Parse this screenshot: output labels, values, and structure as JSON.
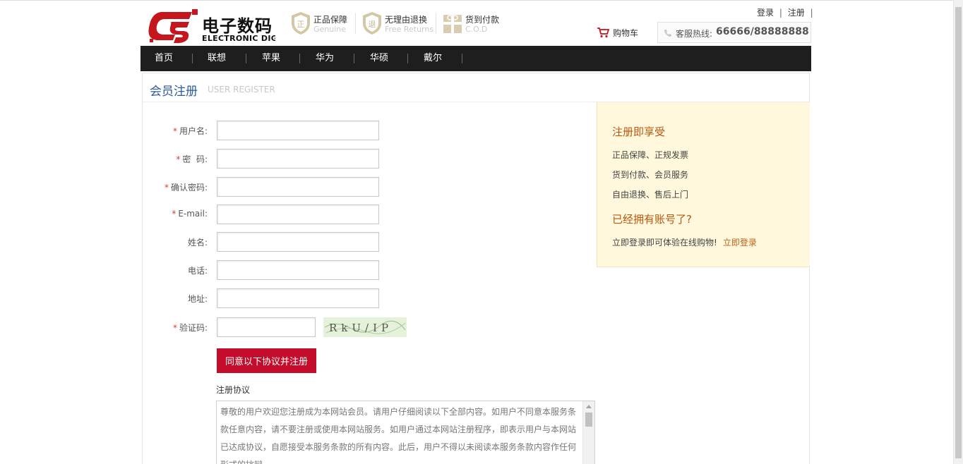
{
  "header": {
    "logo_text": "电子数码",
    "logo_sub": "ELECTRONIC DIGITAL",
    "guarantees": [
      {
        "title": "正品保障",
        "en": "Genuine",
        "icon": "shield-icon"
      },
      {
        "title": "无理由退换",
        "en": "Free Returns",
        "icon": "return-icon"
      },
      {
        "title": "货到付款",
        "en": "C.O.D",
        "icon": "gift-icon"
      }
    ],
    "login_link": "登录",
    "register_link": "注册",
    "link_sep": "|",
    "cart_label": "购物车",
    "hotline_label": "客服热线:",
    "hotline_number": "66666/88888888"
  },
  "nav": {
    "items": [
      "首页",
      "联想",
      "苹果",
      "华为",
      "华硕",
      "戴尔"
    ]
  },
  "panel": {
    "title": "会员注册",
    "title_en": "USER REGISTER"
  },
  "form": {
    "required_mark": "*",
    "fields": [
      {
        "label": "用户名:",
        "required": true,
        "value": ""
      },
      {
        "label": "密  码:",
        "required": true,
        "value": ""
      },
      {
        "label": "确认密码:",
        "required": true,
        "value": ""
      },
      {
        "label": "E-mail:",
        "required": true,
        "value": ""
      },
      {
        "label": "姓名:",
        "required": false,
        "value": ""
      },
      {
        "label": "电话:",
        "required": false,
        "value": ""
      },
      {
        "label": "地址:",
        "required": false,
        "value": ""
      },
      {
        "label": "验证码:",
        "required": true,
        "value": ""
      }
    ],
    "captcha_text": "RkU/IP",
    "submit_label": "同意以下协议并注册",
    "agreement_title": "注册协议",
    "agreement_text": "尊敬的用户欢迎您注册成为本网站会员。请用户仔细阅读以下全部内容。如用户不同意本服务条款任意内容，请不要注册或使用本网站服务。如用户通过本网站注册程序，即表示用户与本网站已达成协议，自愿接受本服务条款的所有内容。此后，用户不得以未阅读本服务条款内容作任何形式的抗辩。"
  },
  "side": {
    "heading1": "注册即享受",
    "benefits": [
      "正品保障、正规发票",
      "货到付款、会员服务",
      "自由退换、售后上门"
    ],
    "heading2": "已经拥有账号了?",
    "login_prompt": "立即登录即可体验在线购物!",
    "login_link": "立即登录"
  },
  "colors": {
    "brand_red": "#c40d2d",
    "nav_bg": "#1e1e1e",
    "title_blue": "#2d5aa0",
    "side_bg": "#fff8dc",
    "side_heading": "#b8570f"
  }
}
